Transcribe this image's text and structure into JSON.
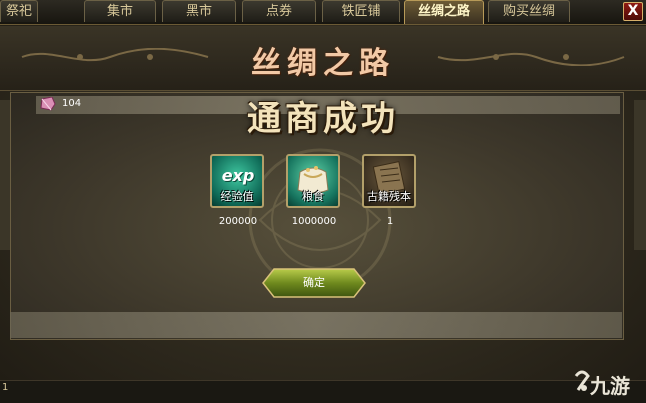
{
  "tabs": [
    {
      "label": "祭祀",
      "active": false
    },
    {
      "label": "集市",
      "active": false
    },
    {
      "label": "黑市",
      "active": false
    },
    {
      "label": "点券",
      "active": false
    },
    {
      "label": "铁匠铺",
      "active": false
    },
    {
      "label": "丝绸之路",
      "active": true
    },
    {
      "label": "购买丝绸",
      "active": false
    }
  ],
  "close_symbol": "X",
  "panel_title": "丝绸之路",
  "resource": {
    "icon": "gem-icon",
    "count": "104"
  },
  "result_title": "通商成功",
  "rewards": [
    {
      "icon": "exp-icon",
      "badge": "exp",
      "label": "经验值",
      "value": "200000"
    },
    {
      "icon": "grain-icon",
      "label": "粮食",
      "value": "1000000"
    },
    {
      "icon": "ancient-book-icon",
      "label": "古籍残本",
      "value": "1"
    }
  ],
  "confirm_label": "确定",
  "status_text": "1",
  "watermark_logo": "九游",
  "colors": {
    "accent_gold": "#b79a58",
    "close_red": "#8f1a12",
    "button_green": "#6f8a1e"
  }
}
